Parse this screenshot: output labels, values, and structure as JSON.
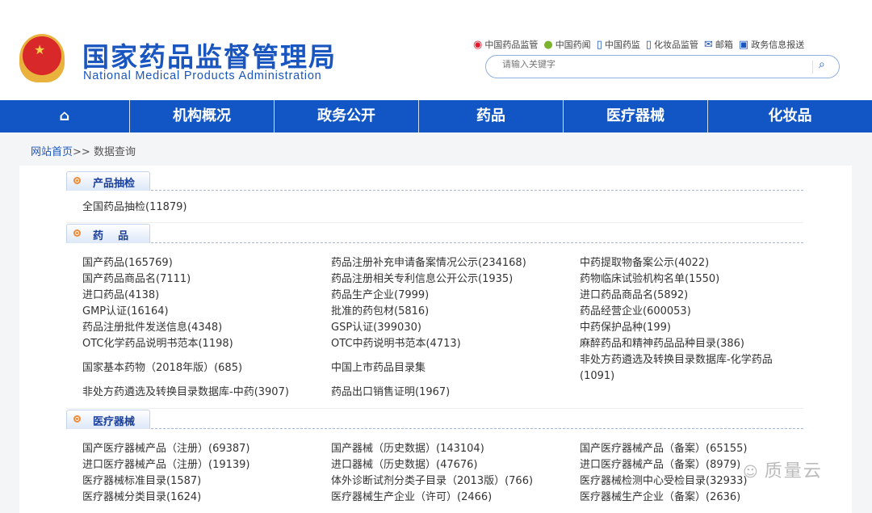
{
  "header": {
    "title_cn": "国家药品监督管理局",
    "title_en": "National Medical Products Administration",
    "links": [
      {
        "icon": "weibo-icon",
        "label": "中国药品监管"
      },
      {
        "icon": "wechat-icon",
        "label": "中国药闻"
      },
      {
        "icon": "mobile-icon",
        "label": "中国药监"
      },
      {
        "icon": "mobile-icon",
        "label": "化妆品监管"
      },
      {
        "icon": "mail-icon",
        "label": "邮箱"
      },
      {
        "icon": "monitor-icon",
        "label": "政务信息报送"
      }
    ],
    "search_placeholder": "请输入关键字"
  },
  "nav": {
    "items": [
      "机构概况",
      "政务公开",
      "药品",
      "医疗器械",
      "化妆品"
    ]
  },
  "breadcrumb": {
    "home": "网站首页",
    "sep": ">> ",
    "current": "数据查询"
  },
  "sections": [
    {
      "label": "产品抽检",
      "items": [
        "全国药品抽检(11879)"
      ]
    },
    {
      "label": "药    品",
      "items": [
        "国产药品(165769)",
        "药品注册补充申请备案情况公示(234168)",
        "中药提取物备案公示(4022)",
        "国产药品商品名(7111)",
        "药品注册相关专利信息公开公示(1935)",
        "药物临床试验机构名单(1550)",
        "进口药品(4138)",
        "药品生产企业(7999)",
        "进口药品商品名(5892)",
        "GMP认证(16164)",
        "批准的药包材(5816)",
        "药品经营企业(600053)",
        "药品注册批件发送信息(4348)",
        "GSP认证(399030)",
        "中药保护品种(199)",
        "OTC化学药品说明书范本(1198)",
        "OTC中药说明书范本(4713)",
        "麻醉药品和精神药品品种目录(386)",
        "国家基本药物（2018年版）(685)",
        "中国上市药品目录集",
        "非处方药遴选及转换目录数据库-化学药品(1091)",
        "非处方药遴选及转换目录数据库-中药(3907)",
        "药品出口销售证明(1967)"
      ]
    },
    {
      "label": "医疗器械",
      "items": [
        "国产医疗器械产品（注册）(69387)",
        "国产器械（历史数据）(143104)",
        "国产医疗器械产品（备案）(65155)",
        "进口医疗器械产品（注册）(19139)",
        "进口器械（历史数据）(47676)",
        "进口医疗器械产品（备案）(8979)",
        "医疗器械标准目录(1587)",
        "体外诊断试剂分类子目录（2013版）(766)",
        "医疗器械检测中心受检目录(32933)",
        "医疗器械分类目录(1624)",
        "医疗器械生产企业（许可）(2466)",
        "医疗器械生产企业（备案）(2636)"
      ]
    }
  ],
  "watermark": "质量云"
}
